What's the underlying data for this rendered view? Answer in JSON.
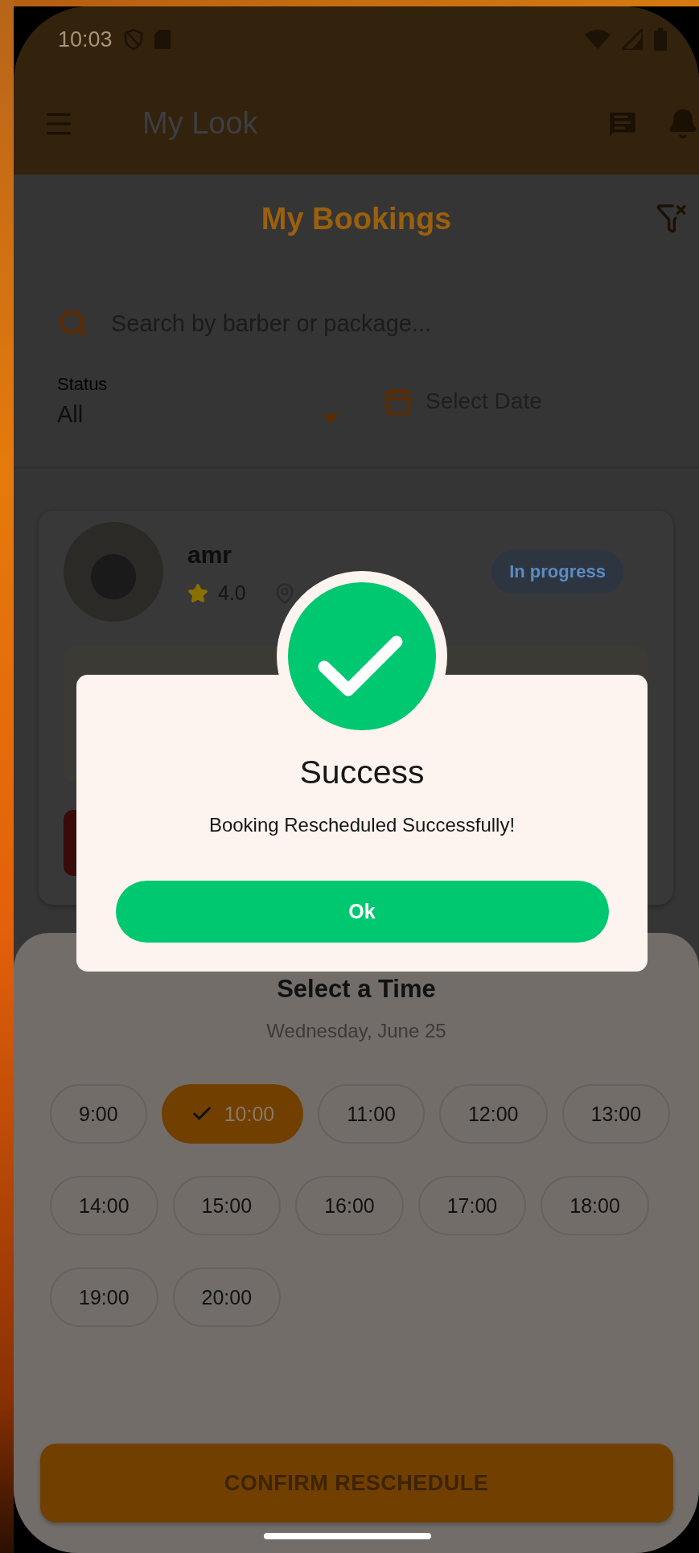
{
  "status_bar": {
    "time": "10:03"
  },
  "app_bar": {
    "title": "My Look"
  },
  "page": {
    "title": "My Bookings"
  },
  "search": {
    "placeholder": "Search by barber or package..."
  },
  "filters": {
    "status_label": "Status",
    "status_value": "All",
    "date_placeholder": "Select Date"
  },
  "booking": {
    "barber": "amr",
    "rating": "4.0",
    "status": "In progress"
  },
  "time_sheet": {
    "title": "Select a Time",
    "date": "Wednesday, June 25",
    "slots": [
      {
        "label": "9:00",
        "selected": false
      },
      {
        "label": "10:00",
        "selected": true
      },
      {
        "label": "11:00",
        "selected": false
      },
      {
        "label": "12:00",
        "selected": false
      },
      {
        "label": "13:00",
        "selected": false
      },
      {
        "label": "14:00",
        "selected": false
      },
      {
        "label": "15:00",
        "selected": false
      },
      {
        "label": "16:00",
        "selected": false
      },
      {
        "label": "17:00",
        "selected": false
      },
      {
        "label": "18:00",
        "selected": false
      },
      {
        "label": "19:00",
        "selected": false
      },
      {
        "label": "20:00",
        "selected": false
      }
    ],
    "confirm": "CONFIRM RESCHEDULE"
  },
  "dialog": {
    "title": "Success",
    "message": "Booking Rescheduled Successfully!",
    "button": "Ok"
  }
}
